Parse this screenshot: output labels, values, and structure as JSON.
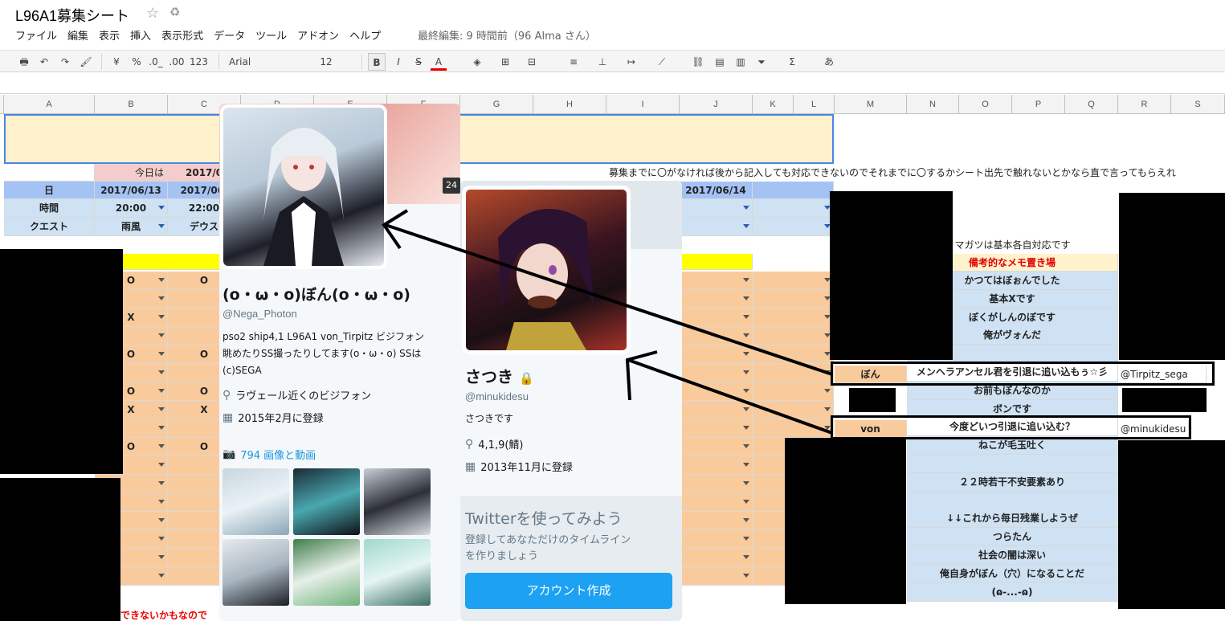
{
  "app": {
    "title": "L96A1募集シート",
    "last_edit": "最終編集: 9 時間前（96 Alma さん）"
  },
  "menu": [
    "ファイル",
    "編集",
    "表示",
    "挿入",
    "表示形式",
    "データ",
    "ツール",
    "アドオン",
    "ヘルプ"
  ],
  "toolbar": {
    "currency": "¥",
    "percent": "%",
    "dec_less": ".0_",
    "dec_more": ".00",
    "format123": "123",
    "font": "Arial",
    "size": "12",
    "bold": "B",
    "italic": "I",
    "strike": "S",
    "textcolor": "A",
    "sum": "Σ",
    "ime": "あ"
  },
  "columns": [
    "A",
    "B",
    "C",
    "D",
    "E",
    "F",
    "G",
    "H",
    "I",
    "J",
    "K",
    "L",
    "M",
    "N",
    "O",
    "P",
    "Q",
    "R",
    "S"
  ],
  "sheet": {
    "today_label": "今日は",
    "today_value": "2017/0",
    "notice": "募集までに〇がなければ後から記入しても対応できないのでそれまでに〇するかシート出先で触れないとかなら直で言ってもらえれ",
    "day_label": "日",
    "time_label": "時間",
    "quest_label": "クエスト",
    "date_b": "2017/06/13",
    "date_c": "2017/06/",
    "date_j": "2017/06/14",
    "time_b": "20:00",
    "time_c": "22:00",
    "quest_b": "雨風",
    "quest_c": "デウス",
    "b_marks": [
      "O",
      "",
      "X",
      "",
      "O",
      "",
      "O",
      "X",
      "",
      "O",
      "",
      "",
      "",
      "",
      "",
      "",
      ""
    ],
    "c_marks": [
      "O",
      "",
      "",
      "",
      "O",
      "",
      "O",
      "X",
      "",
      "O",
      "",
      "",
      "",
      "",
      "",
      "",
      ""
    ],
    "magatsu": "マガツは基本各自対応です",
    "memo_header": "備考的なメモ置き場",
    "memos": [
      "かつてはぼぉんでした",
      "基本Xです",
      "ぼくがしんのぼです",
      "俺がヴォんだ",
      "",
      "メンヘラアンセル君を引退に追い込もぅ☆彡",
      "お前もぼんなのか",
      "ボンです",
      "今度どいつ引退に追い込む？",
      "ねこが毛玉吐く",
      "",
      "２２時若干不安要素あり",
      "",
      "↓↓これから毎日残業しようぜ",
      "つらたん",
      "社会の闇は深い",
      "俺自身がぼん（穴）になることだ",
      "(ɷ-...-ɷ)"
    ],
    "name_bon": "ぼん",
    "name_von": "von",
    "reply_tirpitz": "@Tirpitz_sega",
    "reply_minuki": "@minukidesu",
    "bottom_red": "できないかもなので"
  },
  "profile1": {
    "name": "(o・ω・o)ぼん(o・ω・o)",
    "handle": "@Nega_Photon",
    "bio": "pso2 ship4,1 L96A1 von_Tirpitz ビジフォン眺めたりSS撮ったりしてます(o・ω・o) SSは(c)SEGA",
    "location": "ラヴェール近くのビジフォン",
    "joined": "2015年2月に登録",
    "media": "794 画像と動画",
    "badge": "24"
  },
  "profile2": {
    "name": "さつき",
    "handle": "@minukidesu",
    "bio": "さつきです",
    "location": "4,1,9(鯖)",
    "joined": "2013年11月に登録",
    "cta_title": "Twitterを使ってみよう",
    "cta_text": "登録してあなただけのタイムラインを作りましょう",
    "cta_button": "アカウント作成"
  },
  "colors": {
    "accent": "#1da1f2",
    "header_blue": "#a4c2f4",
    "row_orange": "#f9cb9c",
    "memo_blue": "#cfe2f3",
    "yellow": "#ffff00",
    "banner": "#fff2cc"
  }
}
